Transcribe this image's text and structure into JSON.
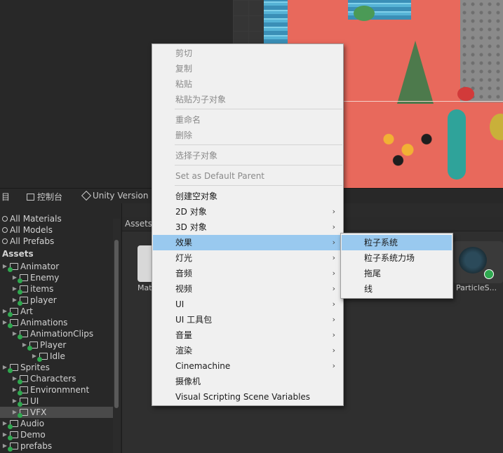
{
  "panel_tabs": {
    "hierarchy_tab_fragment": "目",
    "console_tab": "控制台",
    "unity_version_tab": "Unity Version"
  },
  "hierarchy": [
    {
      "label": "All Materials",
      "depth": 0,
      "type": "search"
    },
    {
      "label": "All Models",
      "depth": 0,
      "type": "search"
    },
    {
      "label": "All Prefabs",
      "depth": 0,
      "type": "search"
    },
    {
      "label": "Assets",
      "depth": 0,
      "type": "header"
    },
    {
      "label": "Animator",
      "depth": 0,
      "type": "folder"
    },
    {
      "label": "Enemy",
      "depth": 1,
      "type": "folder"
    },
    {
      "label": "items",
      "depth": 1,
      "type": "folder"
    },
    {
      "label": "player",
      "depth": 1,
      "type": "folder"
    },
    {
      "label": "Art",
      "depth": 0,
      "type": "folder"
    },
    {
      "label": "Animations",
      "depth": 0,
      "type": "folder"
    },
    {
      "label": "AnimationClips",
      "depth": 1,
      "type": "folder"
    },
    {
      "label": "Player",
      "depth": 2,
      "type": "folder"
    },
    {
      "label": "Idle",
      "depth": 3,
      "type": "folder"
    },
    {
      "label": "Sprites",
      "depth": 0,
      "type": "folder"
    },
    {
      "label": "Characters",
      "depth": 1,
      "type": "folder"
    },
    {
      "label": "Environmnent",
      "depth": 1,
      "type": "folder"
    },
    {
      "label": "UI",
      "depth": 1,
      "type": "folder"
    },
    {
      "label": "VFX",
      "depth": 1,
      "type": "folder",
      "selected": true
    },
    {
      "label": "Audio",
      "depth": 0,
      "type": "folder"
    },
    {
      "label": "Demo",
      "depth": 0,
      "type": "folder"
    },
    {
      "label": "prefabs",
      "depth": 0,
      "type": "folder"
    }
  ],
  "assets": {
    "breadcrumb": "Assets",
    "items": [
      {
        "label": "Mat"
      },
      {
        "label": "ParticleS..."
      }
    ]
  },
  "context_menu": {
    "items": [
      {
        "label": "剪切",
        "disabled": true
      },
      {
        "label": "复制",
        "disabled": true
      },
      {
        "label": "粘贴",
        "disabled": true
      },
      {
        "label": "粘贴为子对象",
        "disabled": true
      },
      {
        "label": "重命名",
        "disabled": true
      },
      {
        "label": "删除",
        "disabled": true
      },
      {
        "label": "选择子对象",
        "disabled": true
      },
      {
        "label": "Set as Default Parent",
        "disabled": true
      },
      {
        "label": "创建空对象"
      },
      {
        "label": "2D 对象",
        "submenu": true
      },
      {
        "label": "3D 对象",
        "submenu": true
      },
      {
        "label": "效果",
        "submenu": true,
        "highlighted": true
      },
      {
        "label": "灯光",
        "submenu": true
      },
      {
        "label": "音频",
        "submenu": true
      },
      {
        "label": "视频",
        "submenu": true
      },
      {
        "label": "UI",
        "submenu": true
      },
      {
        "label": "UI 工具包",
        "submenu": true
      },
      {
        "label": "音量",
        "submenu": true
      },
      {
        "label": "渲染",
        "submenu": true
      },
      {
        "label": "Cinemachine",
        "submenu": true
      },
      {
        "label": "摄像机"
      },
      {
        "label": "Visual Scripting Scene Variables"
      }
    ],
    "submenu_arrow": "›"
  },
  "effects_submenu": {
    "items": [
      {
        "label": "粒子系统",
        "highlighted": true
      },
      {
        "label": "粒子系统力场"
      },
      {
        "label": "拖尾"
      },
      {
        "label": "线"
      }
    ]
  },
  "colors": {
    "menu_bg": "#f0f0f0",
    "menu_highlight": "#99c9ef",
    "folder_badge": "#2fa84f",
    "scene_ground": "#e8695c"
  }
}
